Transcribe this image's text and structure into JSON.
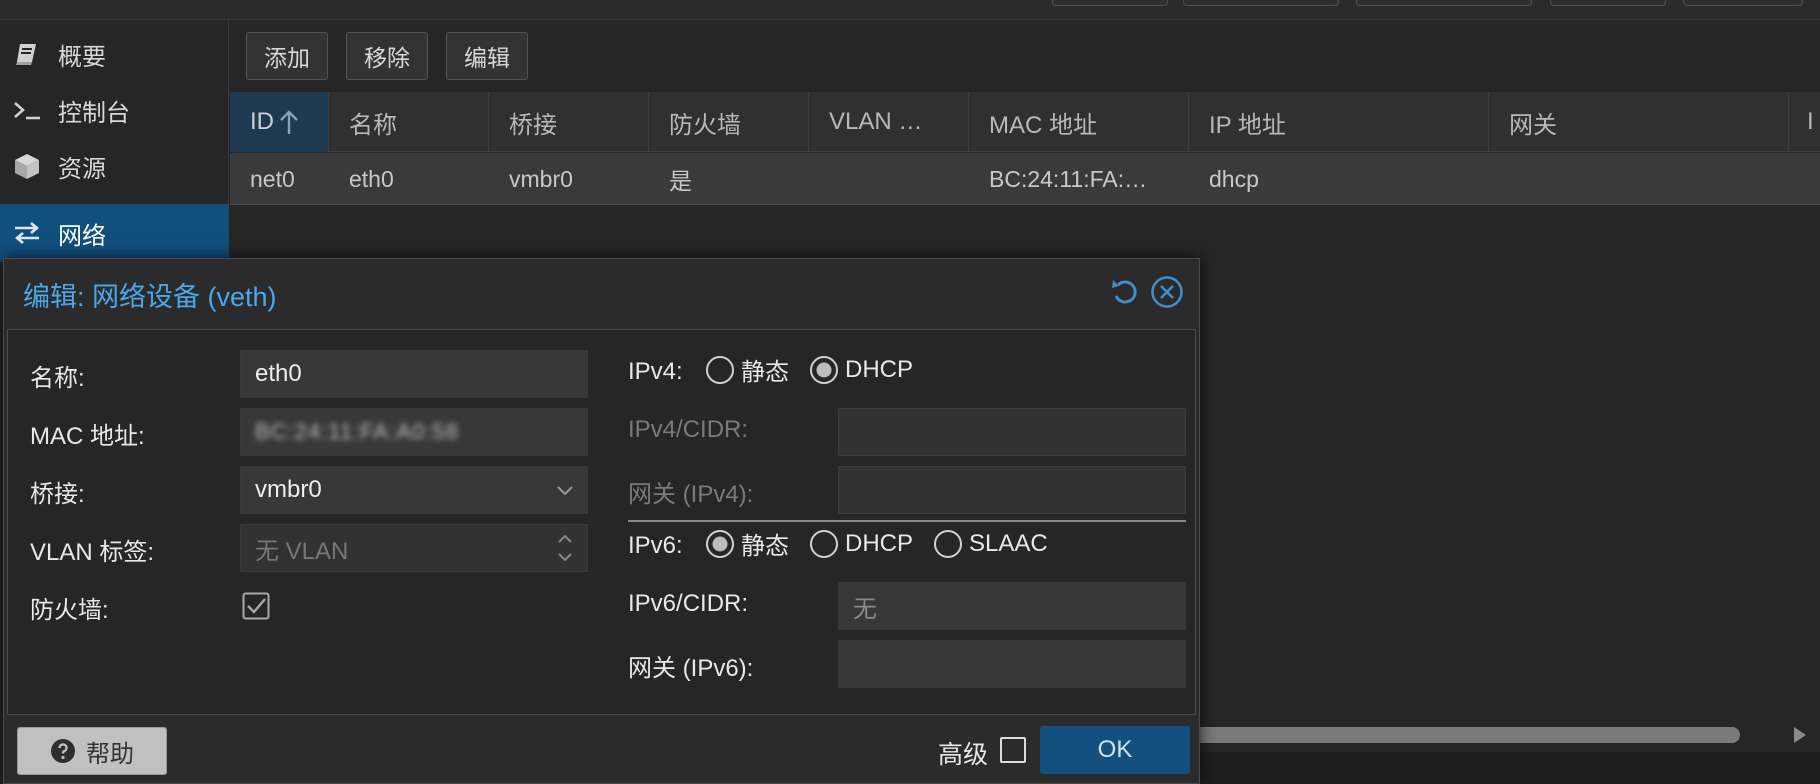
{
  "sidebar": {
    "items": [
      {
        "label": "概要",
        "icon": "book-icon"
      },
      {
        "label": "控制台",
        "icon": "terminal-icon"
      },
      {
        "label": "资源",
        "icon": "cube-icon"
      },
      {
        "label": "网络",
        "icon": "exchange-arrows-icon",
        "active": true
      }
    ]
  },
  "toolbar": {
    "add_label": "添加",
    "remove_label": "移除",
    "edit_label": "编辑"
  },
  "grid": {
    "columns": [
      "ID",
      "名称",
      "桥接",
      "防火墙",
      "VLAN …",
      "MAC 地址",
      "IP 地址",
      "网关",
      "I"
    ],
    "sort_column": "ID",
    "rows": [
      [
        "net0",
        "eth0",
        "vmbr0",
        "是",
        "",
        "BC:24:11:FA:…",
        "dhcp",
        ""
      ]
    ]
  },
  "dialog": {
    "title": "编辑: 网络设备 (veth)",
    "left": {
      "name_label": "名称:",
      "name_value": "eth0",
      "mac_label": "MAC 地址:",
      "mac_value": "BC:24:11:FA:A0:58",
      "bridge_label": "桥接:",
      "bridge_value": "vmbr0",
      "vlan_label": "VLAN 标签:",
      "vlan_placeholder": "无 VLAN",
      "firewall_label": "防火墙:",
      "firewall_checked": true
    },
    "right": {
      "ipv4_label": "IPv4:",
      "ipv4_options": [
        "静态",
        "DHCP"
      ],
      "ipv4_selected": "DHCP",
      "ipv4_cidr_label": "IPv4/CIDR:",
      "ipv4_gw_label": "网关 (IPv4):",
      "ipv6_label": "IPv6:",
      "ipv6_options": [
        "静态",
        "DHCP",
        "SLAAC"
      ],
      "ipv6_selected": "静态",
      "ipv6_cidr_label": "IPv6/CIDR:",
      "ipv6_cidr_placeholder": "无",
      "ipv6_gw_label": "网关 (IPv6):"
    },
    "footer": {
      "help_label": "帮助",
      "advanced_label": "高级",
      "advanced_checked": false,
      "ok_label": "OK"
    }
  },
  "colors": {
    "accent": "#4aa8e8",
    "active_nav": "#114f7d",
    "ok_button": "#13507d",
    "background": "#262626"
  }
}
